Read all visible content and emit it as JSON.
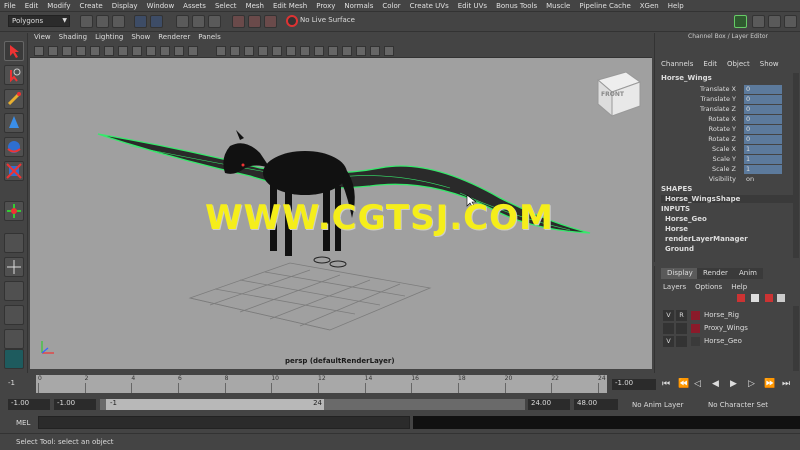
{
  "menubar": [
    "File",
    "Edit",
    "Modify",
    "Create",
    "Display",
    "Window",
    "Assets",
    "Select",
    "Mesh",
    "Edit Mesh",
    "Proxy",
    "Normals",
    "Color",
    "Create UVs",
    "Edit UVs",
    "Bonus Tools",
    "Muscle",
    "Pipeline Cache",
    "XGen",
    "Help"
  ],
  "status": {
    "mode": "Polygons",
    "live_surface": "No Live Surface"
  },
  "panel_menu": [
    "View",
    "Shading",
    "Lighting",
    "Show",
    "Renderer",
    "Panels"
  ],
  "viewport": {
    "camera_label": "persp (defaultRenderLayer)",
    "cube_label": "FRONT",
    "watermark": "WWW.CGTSJ.COM"
  },
  "channel_box": {
    "title": "Channel Box / Layer Editor",
    "menu": [
      "Channels",
      "Edit",
      "Object",
      "Show"
    ],
    "object": "Horse_Wings",
    "attributes": [
      {
        "label": "Translate X",
        "value": "0"
      },
      {
        "label": "Translate Y",
        "value": "0"
      },
      {
        "label": "Translate Z",
        "value": "0"
      },
      {
        "label": "Rotate X",
        "value": "0"
      },
      {
        "label": "Rotate Y",
        "value": "0"
      },
      {
        "label": "Rotate Z",
        "value": "0"
      },
      {
        "label": "Scale X",
        "value": "1"
      },
      {
        "label": "Scale Y",
        "value": "1"
      },
      {
        "label": "Scale Z",
        "value": "1"
      },
      {
        "label": "Visibility",
        "value": "on"
      }
    ],
    "shapes_header": "SHAPES",
    "shape": "Horse_WingsShape",
    "inputs_header": "INPUTS",
    "inputs": [
      "Horse_Geo",
      "Horse",
      "renderLayerManager",
      "Ground"
    ]
  },
  "layer_editor": {
    "tabs": [
      "Display",
      "Render",
      "Anim"
    ],
    "menu": [
      "Layers",
      "Options",
      "Help"
    ],
    "layers": [
      {
        "v": "V",
        "r": "R",
        "name": "Horse_Rig",
        "color": "#8b1a2a"
      },
      {
        "v": "",
        "r": "",
        "name": "Proxy_Wings",
        "color": "#8b1a2a"
      },
      {
        "v": "V",
        "r": "",
        "name": "Horse_Geo",
        "color": "#3a3a3a"
      }
    ]
  },
  "timeline": {
    "current": "-1",
    "ticks": [
      "0",
      "2",
      "4",
      "6",
      "8",
      "10",
      "12",
      "14",
      "16",
      "18",
      "20",
      "22",
      "24"
    ],
    "frame_field": "-1.00"
  },
  "range": {
    "start": "-1.00",
    "inner_start": "-1.00",
    "slider_start": "-1",
    "slider_end": "24",
    "end": "24.00",
    "outer_end": "48.00",
    "anim_layer": "No Anim Layer",
    "character_set": "No Character Set"
  },
  "command": {
    "label": "MEL"
  },
  "help": "Select Tool: select an object"
}
